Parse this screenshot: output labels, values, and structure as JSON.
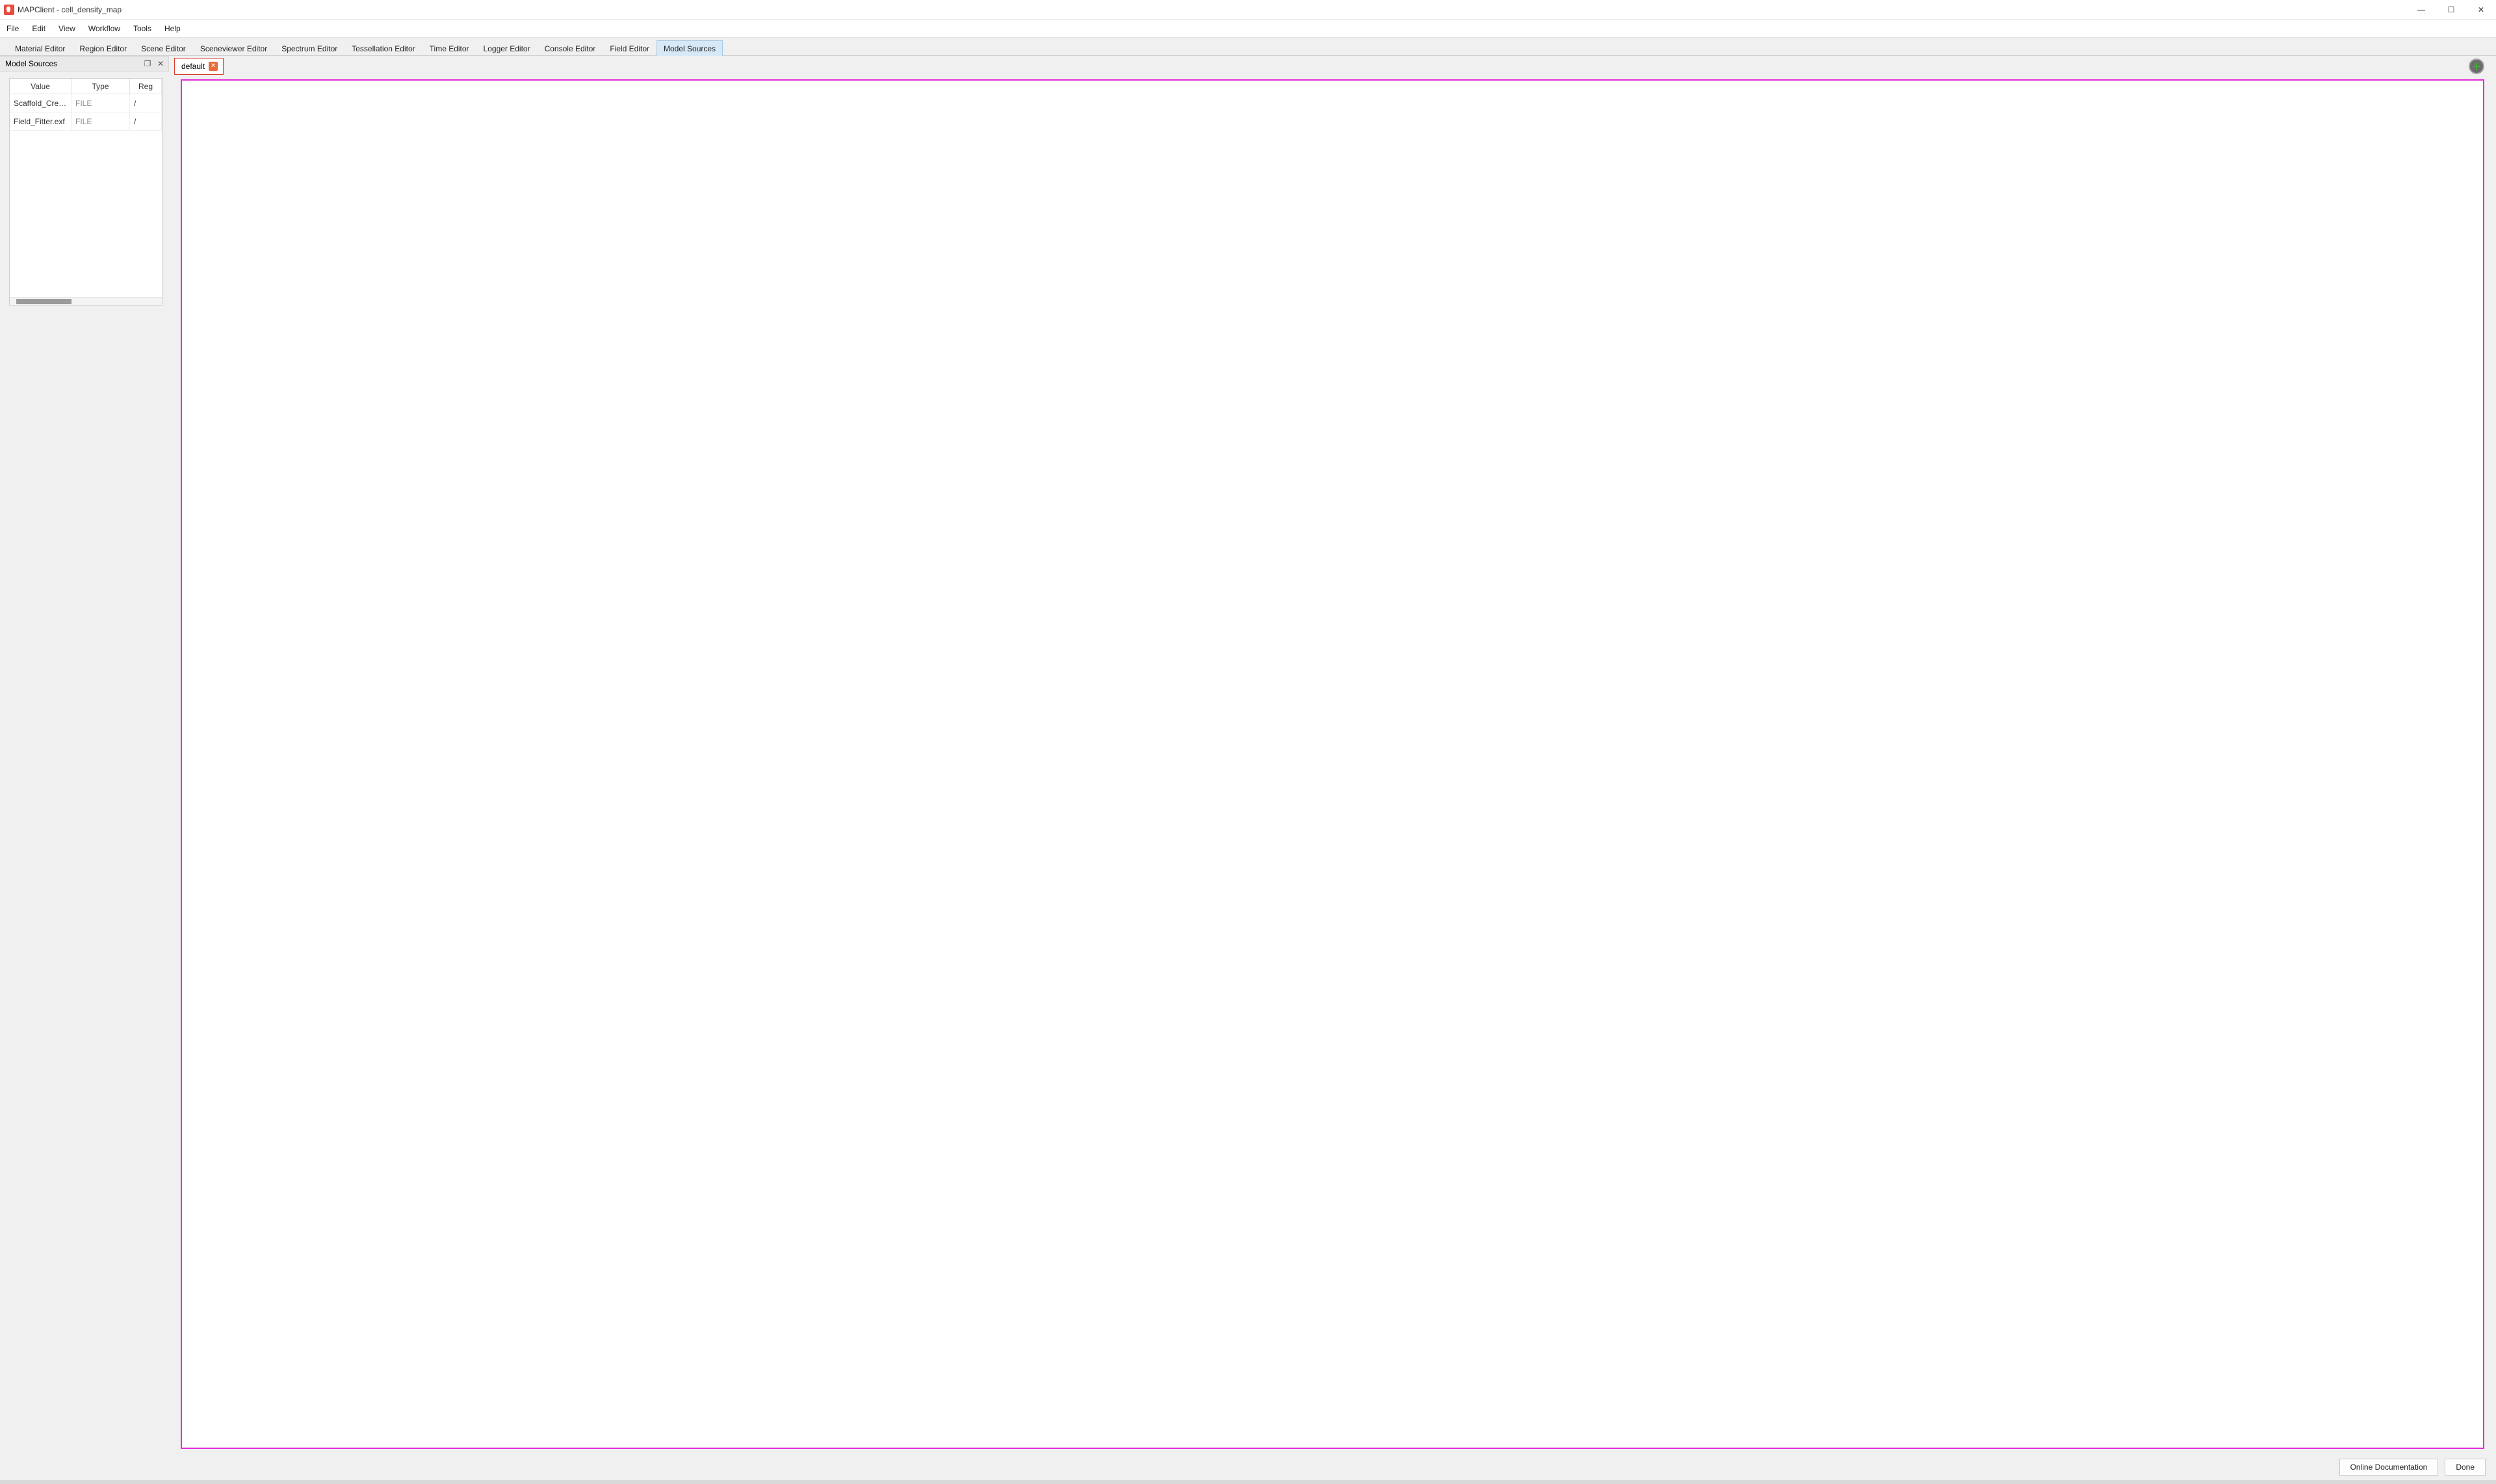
{
  "window": {
    "title": "MAPClient - cell_density_map"
  },
  "menu": {
    "items": [
      "File",
      "Edit",
      "View",
      "Workflow",
      "Tools",
      "Help"
    ]
  },
  "editor_tabs": {
    "items": [
      "Material Editor",
      "Region Editor",
      "Scene Editor",
      "Sceneviewer Editor",
      "Spectrum Editor",
      "Tessellation Editor",
      "Time Editor",
      "Logger Editor",
      "Console Editor",
      "Field Editor",
      "Model Sources"
    ],
    "active_index": 10
  },
  "side_panel": {
    "title": "Model Sources",
    "columns": [
      "Value",
      "Type",
      "Reg"
    ],
    "rows": [
      {
        "value": "Scaffold_Creato...",
        "type": "FILE",
        "reg": "/"
      },
      {
        "value": "Field_Fitter.exf",
        "type": "FILE",
        "reg": "/"
      }
    ]
  },
  "doc_tabs": {
    "items": [
      {
        "label": "default"
      }
    ]
  },
  "footer": {
    "doc_button": "Online Documentation",
    "done_button": "Done"
  },
  "icons": {
    "float": "❐",
    "close": "✕",
    "minimize": "—",
    "maximize": "☐",
    "tab_close": "✕"
  }
}
